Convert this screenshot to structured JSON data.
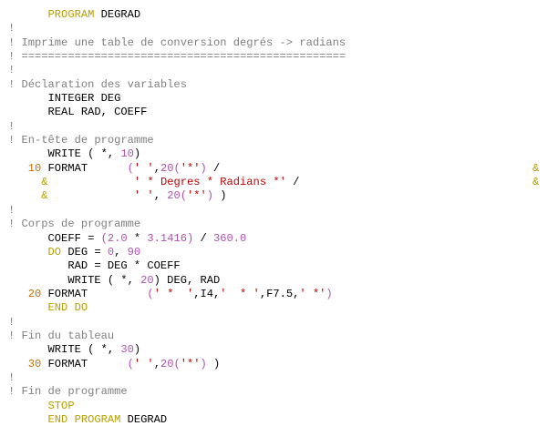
{
  "colors": {
    "plain": "#000000",
    "comment": "#808080",
    "keyword": "#b8a000",
    "number": "#b050b0",
    "string": "#c00000",
    "label": "#c07000",
    "cont_amp": "#b8a000"
  },
  "editor": {
    "lines": [
      [
        {
          "t": "      ",
          "k": "plain"
        },
        {
          "t": "PROGRAM",
          "k": "keyword"
        },
        {
          "t": " DEGRAD",
          "k": "plain"
        }
      ],
      [
        {
          "t": "!",
          "k": "comment"
        }
      ],
      [
        {
          "t": "! Imprime une table de conversion degrés -> radians",
          "k": "comment"
        }
      ],
      [
        {
          "t": "! =================================================",
          "k": "comment"
        }
      ],
      [
        {
          "t": "!",
          "k": "comment"
        }
      ],
      [
        {
          "t": "! Déclaration des variables",
          "k": "comment"
        }
      ],
      [
        {
          "t": "      INTEGER DEG",
          "k": "plain"
        }
      ],
      [
        {
          "t": "      REAL RAD, COEFF",
          "k": "plain"
        }
      ],
      [
        {
          "t": "!",
          "k": "comment"
        }
      ],
      [
        {
          "t": "! En-tête de programme",
          "k": "comment"
        }
      ],
      [
        {
          "t": "      WRITE ( *, ",
          "k": "plain"
        },
        {
          "t": "10",
          "k": "number"
        },
        {
          "t": ")",
          "k": "plain"
        }
      ],
      [
        {
          "t": "   ",
          "k": "plain"
        },
        {
          "t": "10",
          "k": "label"
        },
        {
          "t": " FORMAT      ",
          "k": "plain"
        },
        {
          "t": "(",
          "k": "number"
        },
        {
          "t": "' '",
          "k": "string"
        },
        {
          "t": ",",
          "k": "plain"
        },
        {
          "t": "20",
          "k": "number"
        },
        {
          "t": "(",
          "k": "number"
        },
        {
          "t": "'*'",
          "k": "string"
        },
        {
          "t": ")",
          "k": "number"
        },
        {
          "t": " /",
          "k": "plain"
        }
      ],
      [
        {
          "t": "     ",
          "k": "plain"
        },
        {
          "t": "&",
          "k": "cont_amp"
        },
        {
          "t": "             ",
          "k": "plain"
        },
        {
          "t": "' * Degres * Radians *'",
          "k": "string"
        },
        {
          "t": " /",
          "k": "plain"
        }
      ],
      [
        {
          "t": "     ",
          "k": "plain"
        },
        {
          "t": "&",
          "k": "cont_amp"
        },
        {
          "t": "             ",
          "k": "plain"
        },
        {
          "t": "' '",
          "k": "string"
        },
        {
          "t": ", ",
          "k": "plain"
        },
        {
          "t": "20",
          "k": "number"
        },
        {
          "t": "(",
          "k": "number"
        },
        {
          "t": "'*'",
          "k": "string"
        },
        {
          "t": ")",
          "k": "number"
        },
        {
          "t": " )",
          "k": "plain"
        }
      ],
      [
        {
          "t": "!",
          "k": "comment"
        }
      ],
      [
        {
          "t": "! Corps de programme",
          "k": "comment"
        }
      ],
      [
        {
          "t": "      COEFF = ",
          "k": "plain"
        },
        {
          "t": "(2.0",
          "k": "number"
        },
        {
          "t": " * ",
          "k": "plain"
        },
        {
          "t": "3.1416)",
          "k": "number"
        },
        {
          "t": " / ",
          "k": "plain"
        },
        {
          "t": "360.0",
          "k": "number"
        }
      ],
      [
        {
          "t": "      ",
          "k": "plain"
        },
        {
          "t": "DO",
          "k": "keyword"
        },
        {
          "t": " DEG = ",
          "k": "plain"
        },
        {
          "t": "0",
          "k": "number"
        },
        {
          "t": ", ",
          "k": "plain"
        },
        {
          "t": "90",
          "k": "number"
        }
      ],
      [
        {
          "t": "         RAD = DEG * COEFF",
          "k": "plain"
        }
      ],
      [
        {
          "t": "         WRITE ( *, ",
          "k": "plain"
        },
        {
          "t": "20",
          "k": "number"
        },
        {
          "t": ") DEG, RAD",
          "k": "plain"
        }
      ],
      [
        {
          "t": "   ",
          "k": "plain"
        },
        {
          "t": "20",
          "k": "label"
        },
        {
          "t": " FORMAT         ",
          "k": "plain"
        },
        {
          "t": "(",
          "k": "number"
        },
        {
          "t": "' *  '",
          "k": "string"
        },
        {
          "t": ",I4,",
          "k": "plain"
        },
        {
          "t": "'  * '",
          "k": "string"
        },
        {
          "t": ",F7.5,",
          "k": "plain"
        },
        {
          "t": "' *'",
          "k": "string"
        },
        {
          "t": ")",
          "k": "number"
        }
      ],
      [
        {
          "t": "      ",
          "k": "plain"
        },
        {
          "t": "END DO",
          "k": "keyword"
        }
      ],
      [
        {
          "t": "!",
          "k": "comment"
        }
      ],
      [
        {
          "t": "! Fin du tableau",
          "k": "comment"
        }
      ],
      [
        {
          "t": "      WRITE ( *, ",
          "k": "plain"
        },
        {
          "t": "30",
          "k": "number"
        },
        {
          "t": ")",
          "k": "plain"
        }
      ],
      [
        {
          "t": "   ",
          "k": "plain"
        },
        {
          "t": "30",
          "k": "label"
        },
        {
          "t": " FORMAT      ",
          "k": "plain"
        },
        {
          "t": "(",
          "k": "number"
        },
        {
          "t": "' '",
          "k": "string"
        },
        {
          "t": ",",
          "k": "plain"
        },
        {
          "t": "20",
          "k": "number"
        },
        {
          "t": "(",
          "k": "number"
        },
        {
          "t": "'*'",
          "k": "string"
        },
        {
          "t": ")",
          "k": "number"
        },
        {
          "t": " )",
          "k": "plain"
        }
      ],
      [
        {
          "t": "!",
          "k": "comment"
        }
      ],
      [
        {
          "t": "! Fin de programme",
          "k": "comment"
        }
      ],
      [
        {
          "t": "      ",
          "k": "plain"
        },
        {
          "t": "STOP",
          "k": "keyword"
        }
      ],
      [
        {
          "t": "      ",
          "k": "plain"
        },
        {
          "t": "END PROGRAM",
          "k": "keyword"
        },
        {
          "t": " DEGRAD",
          "k": "plain"
        }
      ]
    ],
    "continuation_marks": [
      {
        "line": 11,
        "text": "&"
      },
      {
        "line": 12,
        "text": "&"
      }
    ]
  }
}
